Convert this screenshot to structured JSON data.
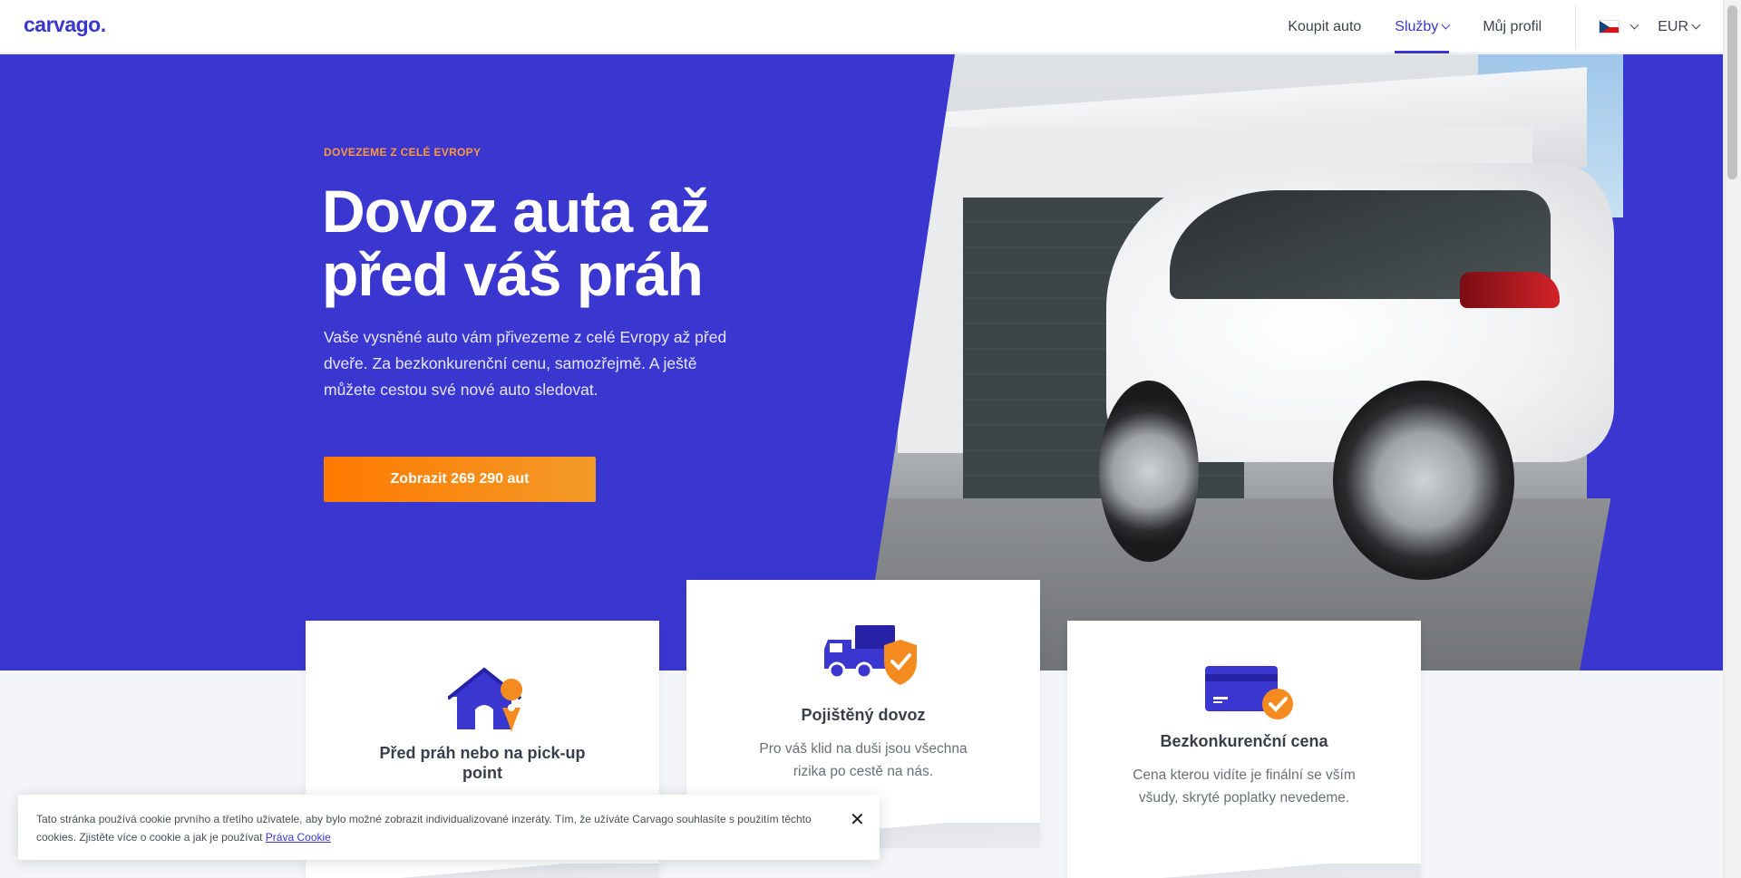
{
  "header": {
    "logo": "carvago.",
    "nav": [
      {
        "label": "Koupit auto"
      },
      {
        "label": "Služby"
      },
      {
        "label": "Můj profil"
      }
    ],
    "currency": "EUR",
    "language_icon": "czech-flag-icon"
  },
  "hero": {
    "kicker": "DOVEZEME Z CELÉ EVROPY",
    "title": "Dovoz auta až před váš práh",
    "lead": "Vaše vysněné auto vám přivezeme z celé Evropy až před dveře. Za bezkonkurenční cenu, samozřejmě. A ještě můžete cestou své nové auto sledovat.",
    "cta": "Zobrazit 269 290 aut"
  },
  "cards": [
    {
      "title": "Před práh nebo na pick-up point",
      "icon": "house-location-icon"
    },
    {
      "title": "Pojištěný dovoz",
      "desc": "Pro váš klid na duši jsou všechna rizika po cestě na nás.",
      "icon": "insured-truck-icon"
    },
    {
      "title": "Bezkonkurenční cena",
      "desc": "Cena kterou vidíte je finální se vším všudy, skryté poplatky nevedeme.",
      "icon": "credit-card-check-icon"
    }
  ],
  "cookie": {
    "text": "Tato stránka používá cookie prvního a třetího uživatele, aby bylo možné zobrazit individualizované inzeráty. Tím, že užíváte Carvago souhlasíte s použitím těchto cookies. Zjistěte více o cookie a jak je používat ",
    "link": "Práva Cookie",
    "close": "✕"
  },
  "colors": {
    "brand": "#3a36d0",
    "accent": "#ff7a00"
  }
}
